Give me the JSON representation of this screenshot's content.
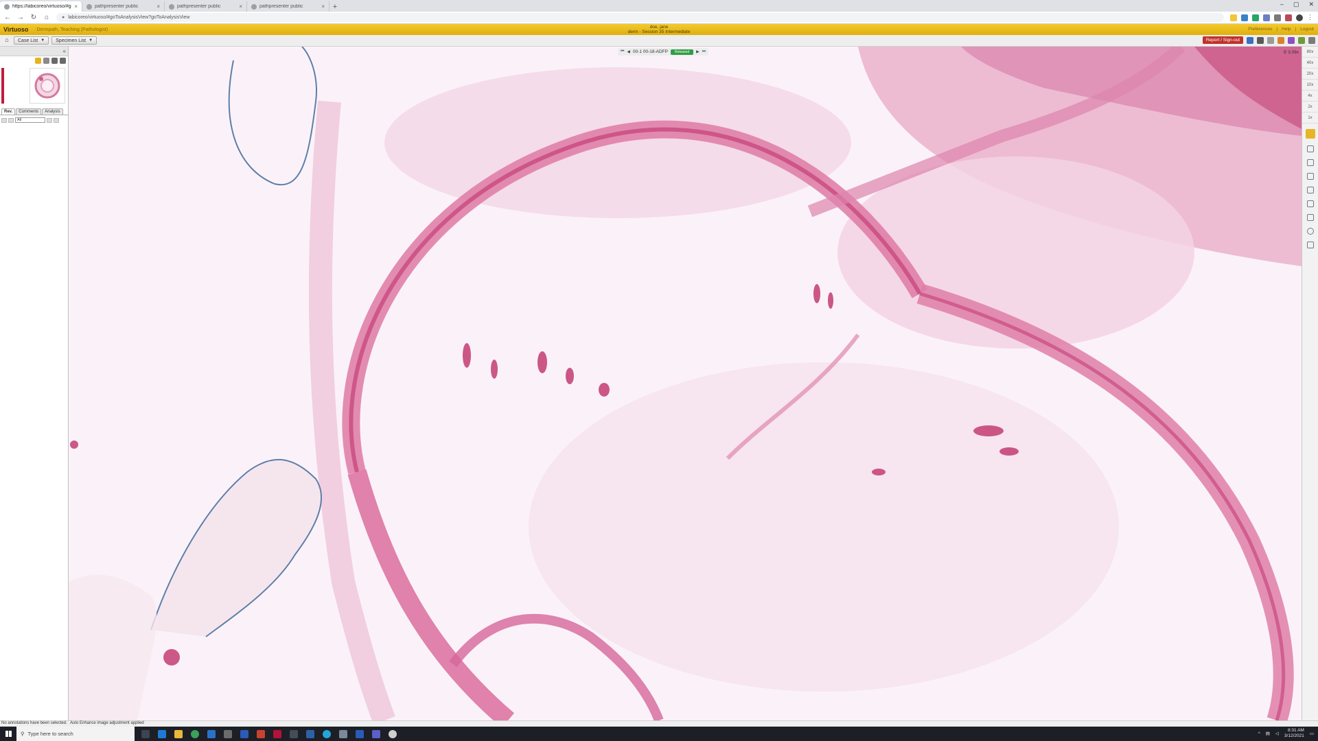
{
  "browser": {
    "tabs": [
      {
        "label": "https://labicoreo/virtuoso/#goTo",
        "active": true
      },
      {
        "label": "pathpresenter public",
        "active": false
      },
      {
        "label": "pathpresenter public",
        "active": false
      },
      {
        "label": "pathpresenter public",
        "active": false
      }
    ],
    "new_tab": "+",
    "url": "labicoreo/virtuoso/#goToAnalysisView?goToAnalysisView"
  },
  "app": {
    "brand": "Virtuoso",
    "workspace": "Dermpath, Teaching (Pathologist)",
    "user_line1": "doe, jane",
    "user_line2": "derm - Session 35 Intermediate",
    "top_links": [
      "Preferences",
      "Help",
      "Logout"
    ]
  },
  "toolbar": {
    "case_list": "Case List",
    "specimen_list": "Specimen List",
    "report_button": "Report / Sign-out"
  },
  "left_panel": {
    "tabs": [
      "Rev.",
      "Comments",
      "Analysis"
    ],
    "filter_value": "All"
  },
  "viewer": {
    "slide_id": "00-1 00-18-ADFP",
    "status_badge": "Released",
    "zoom_level": "3.09x"
  },
  "zoom_levels": [
    "80x",
    "40x",
    "20x",
    "10x",
    "4x",
    "2x",
    "1x"
  ],
  "status": {
    "left": "No annotations have been selected.",
    "main": "Auto Enhance image adjustment applied"
  },
  "taskbar": {
    "search_placeholder": "Type here to search",
    "time": "8:31 AM",
    "date": "3/12/2021"
  },
  "colors": {
    "header_yellow": "#f2cb2c",
    "report_red": "#c0312b",
    "released_green": "#2f9e44",
    "tissue_pink": "#e07aa2"
  }
}
